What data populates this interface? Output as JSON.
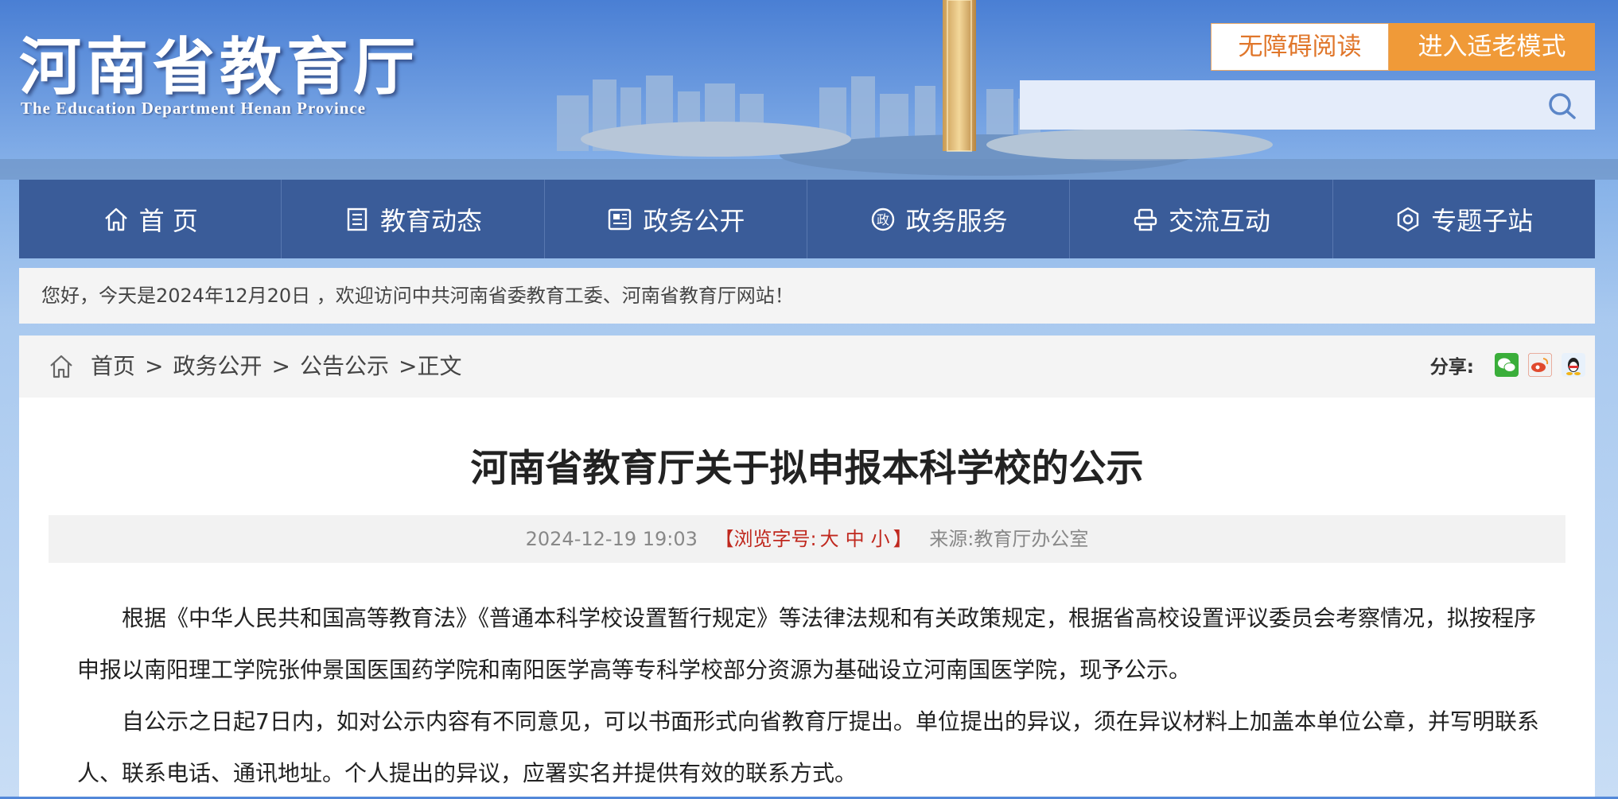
{
  "header": {
    "logo_cn": "河南省教育厅",
    "logo_en": "The Education Department Henan Province",
    "accessibility_button": "无障碍阅读",
    "elder_mode_button": "进入适老模式",
    "search_placeholder": ""
  },
  "nav": {
    "items": [
      {
        "label": "首 页",
        "icon": "home-icon"
      },
      {
        "label": "教育动态",
        "icon": "document-icon"
      },
      {
        "label": "政务公开",
        "icon": "newspaper-icon"
      },
      {
        "label": "政务服务",
        "icon": "service-icon"
      },
      {
        "label": "交流互动",
        "icon": "chat-icon"
      },
      {
        "label": "专题子站",
        "icon": "topic-icon"
      }
    ]
  },
  "welcome": "您好，今天是2024年12月20日 ，欢迎访问中共河南省委教育工委、河南省教育厅网站！",
  "breadcrumb": {
    "items": [
      "首页",
      "政务公开",
      "公告公示"
    ],
    "current": ">正文",
    "separator": ">"
  },
  "share": {
    "label": "分享:",
    "icons": [
      "wechat-icon",
      "weibo-icon",
      "qq-icon"
    ]
  },
  "article": {
    "title": "河南省教育厅关于拟申报本科学校的公示",
    "date": "2024-12-19 19:03",
    "font_size_label": "【浏览字号:",
    "font_sizes": [
      "大",
      "中",
      "小"
    ],
    "font_size_close": "】",
    "source_label": "来源:",
    "source": "教育厅办公室",
    "paragraphs": [
      "根据《中华人民共和国高等教育法》《普通本科学校设置暂行规定》等法律法规和有关政策规定，根据省高校设置评议委员会考察情况，拟按程序申报以南阳理工学院张仲景国医国药学院和南阳医学高等专科学校部分资源为基础设立河南国医学院，现予公示。",
      "自公示之日起7日内，如对公示内容有不同意见，可以书面形式向省教育厅提出。单位提出的异议，须在异议材料上加盖本单位公章，并写明联系人、联系电话、通讯地址。个人提出的异议，应署实名并提供有效的联系方式。"
    ]
  },
  "colors": {
    "nav_bg": "#3a5c99",
    "accent_orange": "#f09a38",
    "accent_red": "#c0281e"
  }
}
